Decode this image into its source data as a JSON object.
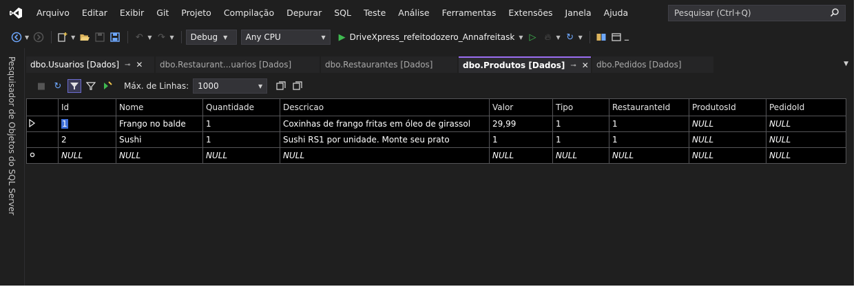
{
  "menu": {
    "items": [
      "Arquivo",
      "Editar",
      "Exibir",
      "Git",
      "Projeto",
      "Compilação",
      "Depurar",
      "SQL",
      "Teste",
      "Análise",
      "Ferramentas",
      "Extensões",
      "Janela",
      "Ajuda"
    ],
    "search_placeholder": "Pesquisar (Ctrl+Q)"
  },
  "toolbar": {
    "configuration": "Debug",
    "platform": "Any CPU",
    "startup_project": "DriveXpress_refeitodozero_Annafreitask"
  },
  "side_panel": {
    "label": "Pesquisador de Objetos do SQL Server"
  },
  "tabs": [
    {
      "label": "dbo.Usuarios [Dados]",
      "pinned": true,
      "active": false
    },
    {
      "label": "dbo.Restaurant...uarios [Dados]",
      "pinned": false,
      "active": false
    },
    {
      "label": "dbo.Restaurantes [Dados]",
      "pinned": false,
      "active": false
    },
    {
      "label": "dbo.Produtos [Dados]",
      "pinned": true,
      "active": true
    },
    {
      "label": "dbo.Pedidos [Dados]",
      "pinned": false,
      "active": false
    }
  ],
  "grid_toolbar": {
    "max_rows_label": "Máx. de Linhas:",
    "max_rows_value": "1000"
  },
  "table": {
    "columns": [
      "Id",
      "Nome",
      "Quantidade",
      "Descricao",
      "Valor",
      "Tipo",
      "RestauranteId",
      "ProdutosId",
      "PedidoId"
    ],
    "rows": [
      [
        "1",
        "Frango no balde",
        "1",
        "Coxinhas de frango fritas em óleo de girassol",
        "29,99",
        "1",
        "1",
        "NULL",
        "NULL"
      ],
      [
        "2",
        "Sushi",
        "1",
        "Sushi RS1 por unidade. Monte seu prato",
        "1",
        "1",
        "1",
        "NULL",
        "NULL"
      ],
      [
        "NULL",
        "NULL",
        "NULL",
        "NULL",
        "NULL",
        "NULL",
        "NULL",
        "NULL",
        "NULL"
      ]
    ],
    "row_markers": [
      "current-row-arrow",
      "",
      "new-row-star"
    ]
  },
  "colors": {
    "background": "#1f1f1f",
    "grid_background": "#000000",
    "accent": "#9b6ef3",
    "selection": "#3f6fd6",
    "run_green": "#3fb950"
  }
}
